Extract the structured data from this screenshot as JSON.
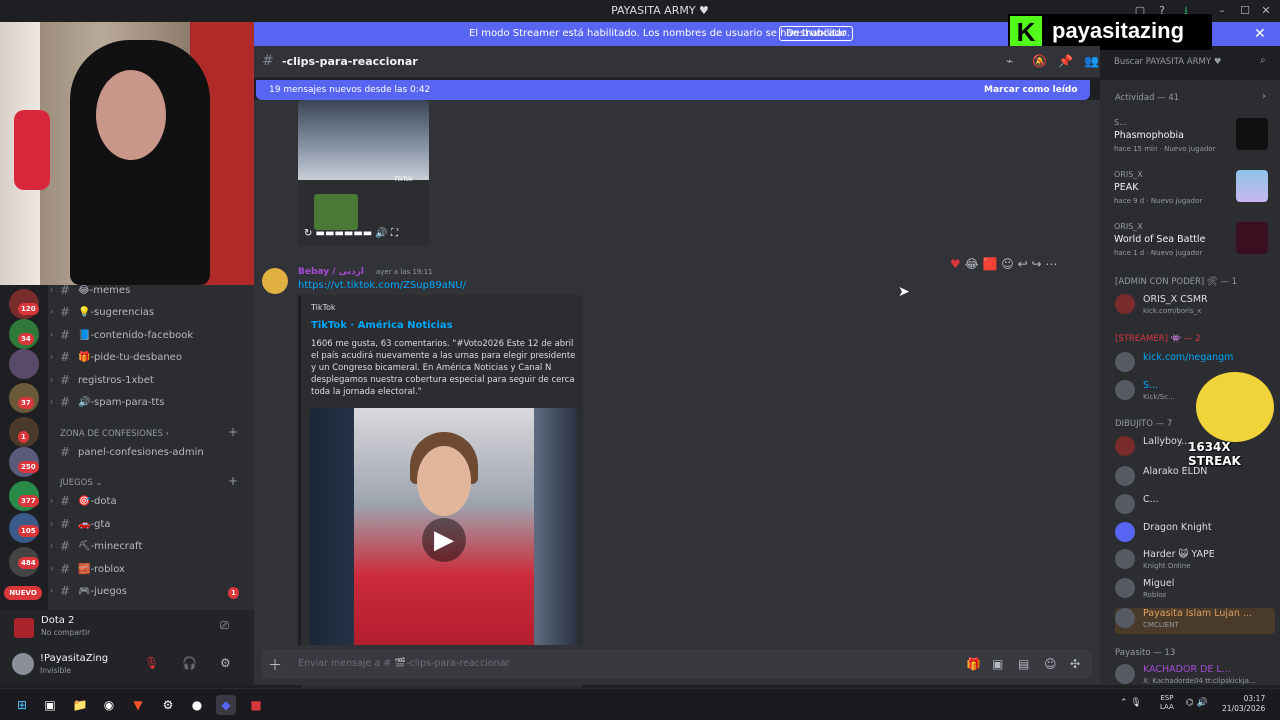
{
  "window": {
    "title": "PAYASITA ARMY ♥"
  },
  "banner": {
    "text": "El modo Streamer está habilitado. Los nombres de usuario se han truncado.",
    "button": "Deshabilitar"
  },
  "brand": {
    "name": "payasitazing",
    "letter": "K"
  },
  "channel": {
    "name": "-clips-para-reaccionar"
  },
  "search": {
    "placeholder": "Buscar PAYASITA ARMY ♥"
  },
  "new_messages": {
    "text": "19 mensajes nuevos desde las 0:42",
    "mark": "Marcar como leído"
  },
  "message": {
    "author": "Bebay / اردنی",
    "time": "ayer a las 19:11",
    "link": "https://vt.tiktok.com/ZSup89aNU/",
    "embed": {
      "provider": "TikTok",
      "title": "TikTok · América Noticias",
      "description": "1606 me gusta, 63 comentarios. \"#Voto2026 Este 12 de abril el país acudirá nuevamente a las urnas para elegir presidente y un Congreso bicameral. En América Noticias y Canal N desplegamos nuestra cobertura especial para seguir de cerca toda la jornada electoral.\""
    }
  },
  "video_thumb": {
    "label": "TikTok"
  },
  "composer": {
    "placeholder": "Enviar mensaje a # 🎬-clips-para-reaccionar"
  },
  "sidebar": {
    "channels_top": [
      {
        "name": "😂-memes"
      },
      {
        "name": "💡-sugerencias"
      },
      {
        "name": "📘-contenido-facebook"
      },
      {
        "name": "🎁-pide-tu-desbaneo"
      },
      {
        "name": "registros-1xbet"
      },
      {
        "name": "🔊-spam-para-tts"
      }
    ],
    "category1": "ZONA DE CONFESIONES",
    "channels_mid": [
      {
        "name": "panel-confesiones-admin"
      }
    ],
    "category2": "JUEGOS",
    "channels_games": [
      {
        "name": "🎯-dota"
      },
      {
        "name": "🚗-gta"
      },
      {
        "name": "⛏-minecraft"
      },
      {
        "name": "🧱-roblox"
      },
      {
        "name": "🎮-juegos"
      }
    ],
    "juegos_badge": "1"
  },
  "servers": {
    "badges": [
      "120",
      "34",
      "37",
      "1",
      "250",
      "377",
      "105",
      "484"
    ],
    "nuevo": "NUEVO"
  },
  "activity": {
    "game": "Dota 2",
    "status": "No compartir"
  },
  "user": {
    "name": "!PayasitaZing",
    "status": "Invisible"
  },
  "members": {
    "activity_header": "Actividad — 41",
    "activities": [
      {
        "user": "S...",
        "game": "Phasmophobia",
        "meta": "hace 15 min · Nuevo jugador"
      },
      {
        "user": "ORIS_X",
        "game": "PEAK",
        "meta": "hace 9 d · Nuevo jugador"
      },
      {
        "user": "ORIS_X",
        "game": "World of Sea Battle",
        "meta": "hace 1 d · Nuevo jugador"
      }
    ],
    "admin_header": "[ADMIN CON PODER] 🛠 — 1",
    "admin": [
      {
        "name": "ORIS_X  CSMR",
        "sub": "kick.com/boris_x"
      }
    ],
    "streamer_header": "[STREAMER] 👾 — 2",
    "streamers": [
      {
        "name": "kick.com/negangm",
        "sub": ""
      },
      {
        "name": "S...",
        "sub": "Kick/Sc..."
      }
    ],
    "dibujito_header": "DIBUJITO — 7",
    "dibujito": [
      {
        "name": "Lallyboy...",
        "sub": ""
      },
      {
        "name": "Alarako  ELDN",
        "sub": ""
      },
      {
        "name": "C...",
        "sub": ""
      },
      {
        "name": "Dragon Knight",
        "sub": ""
      },
      {
        "name": "Harder 😺  YAPE",
        "sub": "Knight Online"
      },
      {
        "name": "Miguel",
        "sub": "Roblox"
      },
      {
        "name": "Payasita Islam Lujan ...",
        "sub": "CMCLIENT"
      }
    ],
    "payasito_header": "Payasito — 13",
    "payasito": [
      {
        "name": "KACHADOR DE L...",
        "sub": "X: Kachadorde04 tt:clipskickja..."
      }
    ]
  },
  "streak": "1634X STREAK",
  "taskbar": {
    "lang_top": "ESP",
    "lang_bottom": "LAA",
    "time": "03:17",
    "date": "21/03/2026"
  }
}
